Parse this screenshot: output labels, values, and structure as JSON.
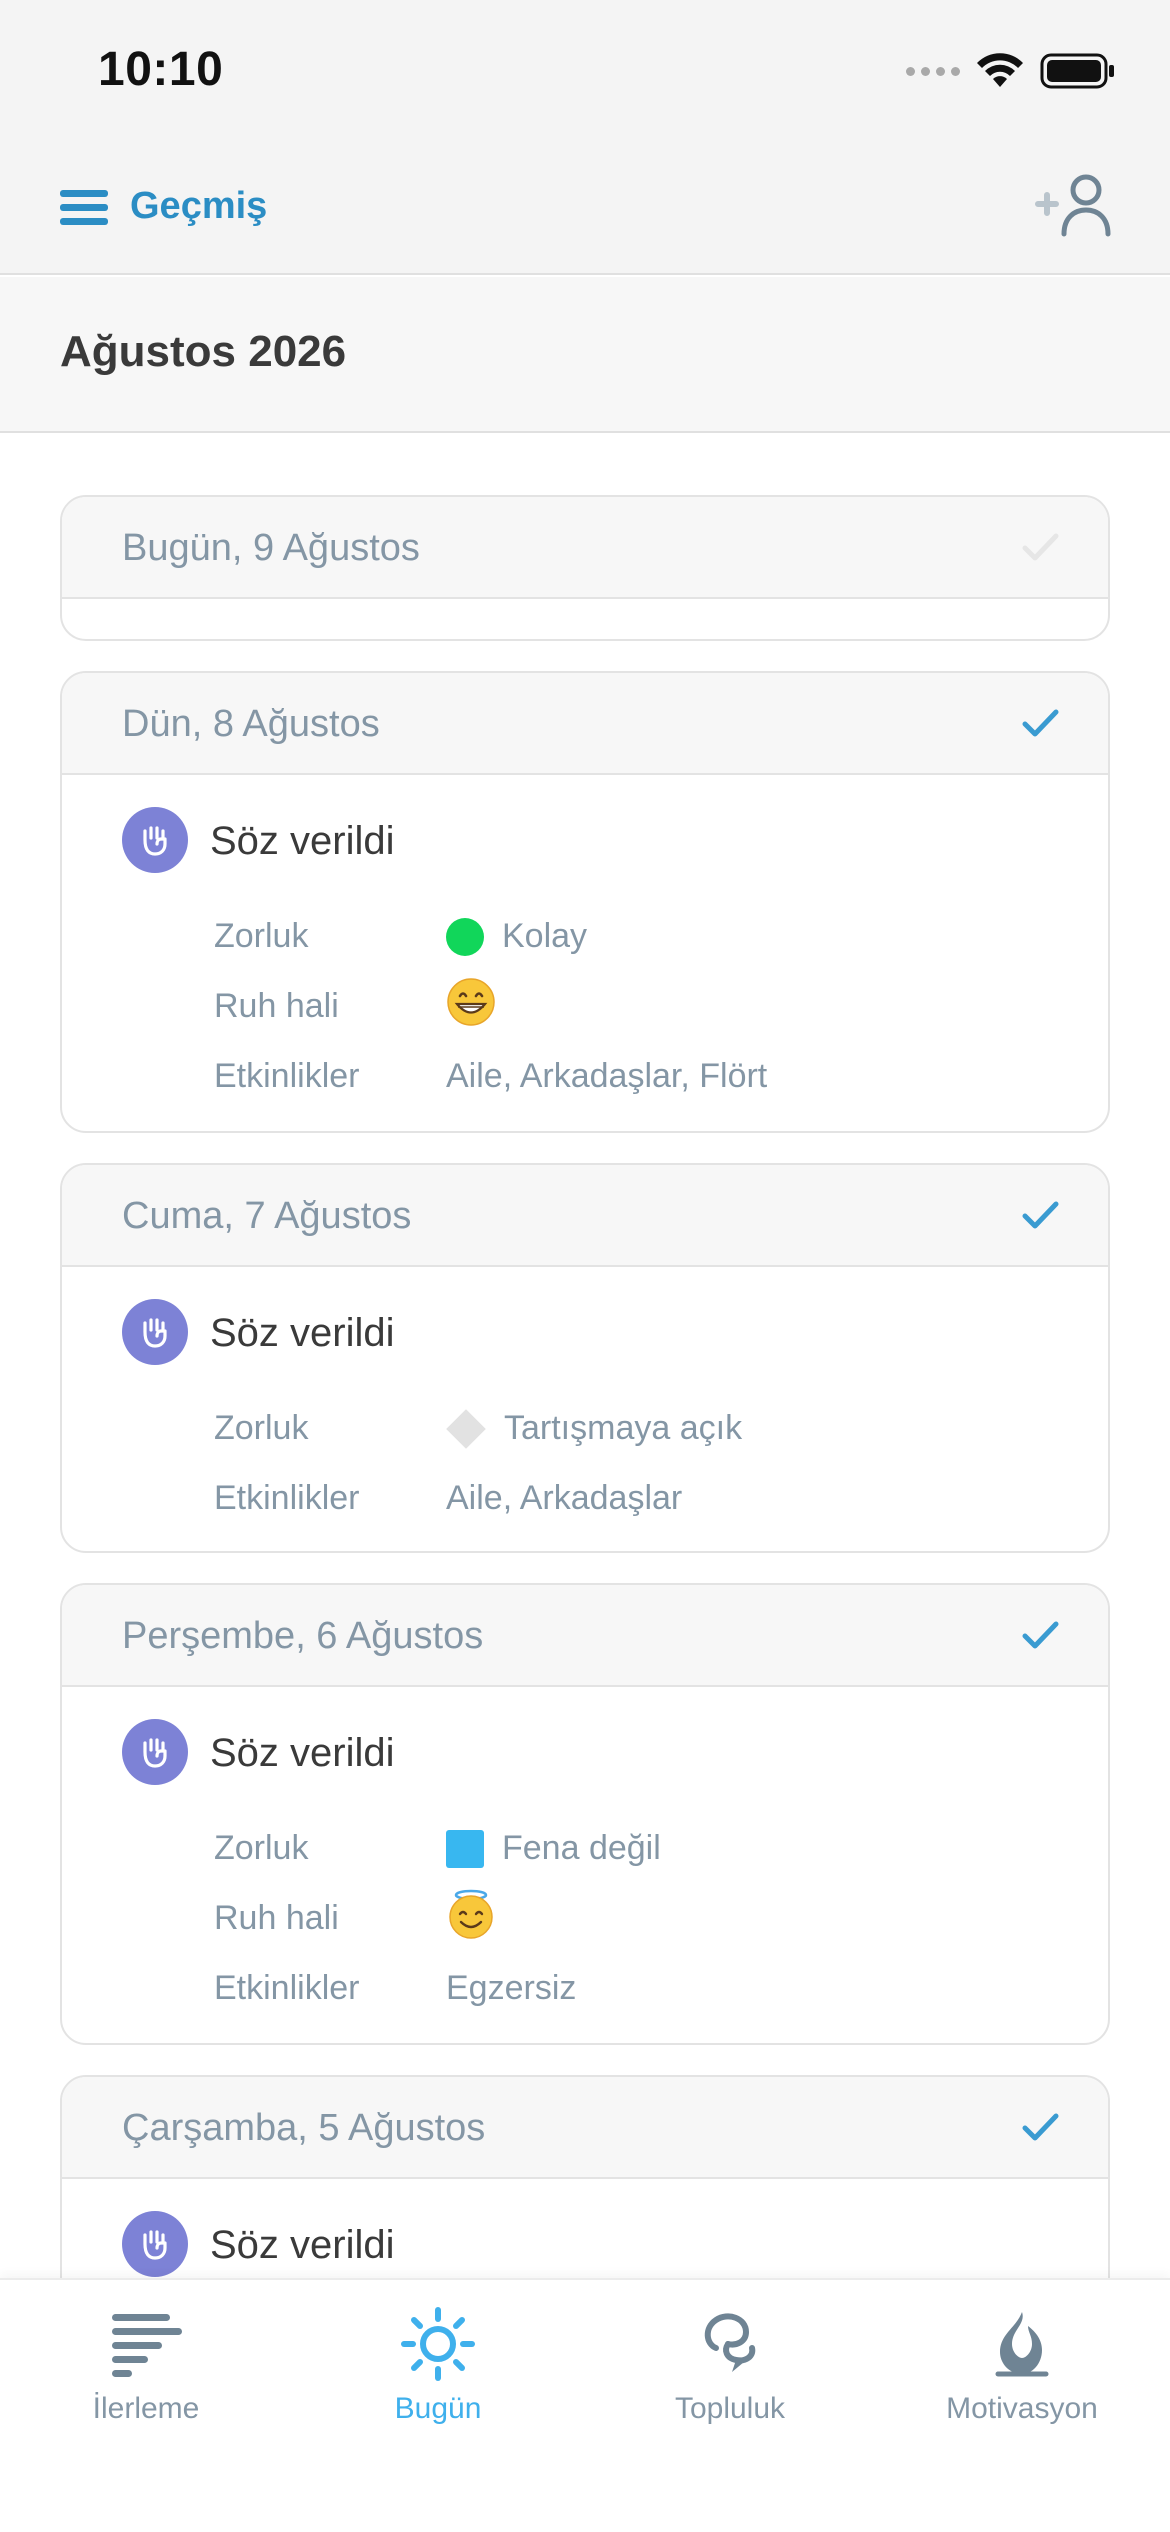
{
  "status_bar": {
    "time": "10:10"
  },
  "nav": {
    "title": "Geçmiş"
  },
  "month": {
    "title": "Ağustos 2026"
  },
  "days": [
    {
      "date": "Bugün, 9 Ağustos"
    },
    {
      "date": "Dün, 8 Ağustos",
      "entry": "Söz verildi",
      "labels": {
        "difficulty": "Zorluk",
        "mood": "Ruh hali",
        "activities": "Etkinlikler"
      },
      "difficulty": "Kolay",
      "activities": "Aile, Arkadaşlar, Flört",
      "mood_icon": "grinning-face"
    },
    {
      "date": "Cuma, 7 Ağustos",
      "entry": "Söz verildi",
      "labels": {
        "difficulty": "Zorluk",
        "activities": "Etkinlikler"
      },
      "difficulty": "Tartışmaya açık",
      "activities": "Aile, Arkadaşlar"
    },
    {
      "date": "Perşembe, 6 Ağustos",
      "entry": "Söz verildi",
      "labels": {
        "difficulty": "Zorluk",
        "mood": "Ruh hali",
        "activities": "Etkinlikler"
      },
      "difficulty": "Fena değil",
      "activities": "Egzersiz",
      "mood_icon": "smiling-face-with-halo"
    },
    {
      "date": "Çarşamba, 5 Ağustos",
      "entry": "Söz verildi"
    }
  ],
  "tabs": [
    {
      "label": "İlerleme",
      "icon": "progress-bars-icon"
    },
    {
      "label": "Bugün",
      "icon": "sun-icon",
      "active": true
    },
    {
      "label": "Topluluk",
      "icon": "community-icon"
    },
    {
      "label": "Motivasyon",
      "icon": "motivation-icon"
    }
  ],
  "colors": {
    "accent": "#2b8dc4",
    "tab_active": "#3fb0ec",
    "promise_badge": "#7d82d6",
    "difficulty_easy": "#11d65a",
    "difficulty_ok": "#38b7f0",
    "difficulty_debatable": "#e2e2e2",
    "muted_text": "#8496a5"
  }
}
